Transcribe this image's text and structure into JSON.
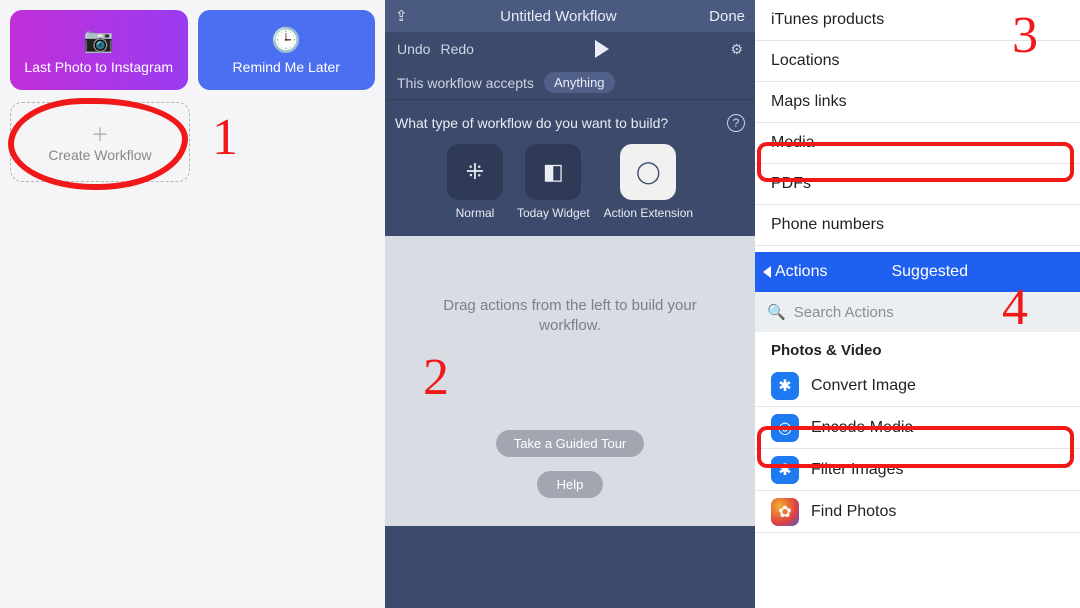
{
  "panel1": {
    "tile1_label": "Last Photo to Instagram",
    "tile2_label": "Remind Me Later",
    "create_label": "Create Workflow"
  },
  "panel2": {
    "title": "Untitled Workflow",
    "done": "Done",
    "undo": "Undo",
    "redo": "Redo",
    "accepts_label": "This workflow accepts",
    "accepts_value": "Anything",
    "build_prompt": "What type of workflow do you want to build?",
    "types": {
      "normal": "Normal",
      "today": "Today Widget",
      "action": "Action Extension"
    },
    "workspace_hint": "Drag actions from the left to build your workflow.",
    "tour_btn": "Take a Guided Tour",
    "help_btn": "Help"
  },
  "panel3": {
    "categories": {
      "0": "iTunes products",
      "1": "Locations",
      "2": "Maps links",
      "3": "Media",
      "4": "PDFs",
      "5": "Phone numbers"
    },
    "back_label": "Actions",
    "header_title": "Suggested",
    "search_placeholder": "Search Actions",
    "section": "Photos & Video",
    "actions": {
      "0": "Convert Image",
      "1": "Encode Media",
      "2": "Filter Images",
      "3": "Find Photos"
    }
  },
  "annotations": {
    "n1": "1",
    "n2": "2",
    "n3": "3",
    "n4": "4"
  }
}
